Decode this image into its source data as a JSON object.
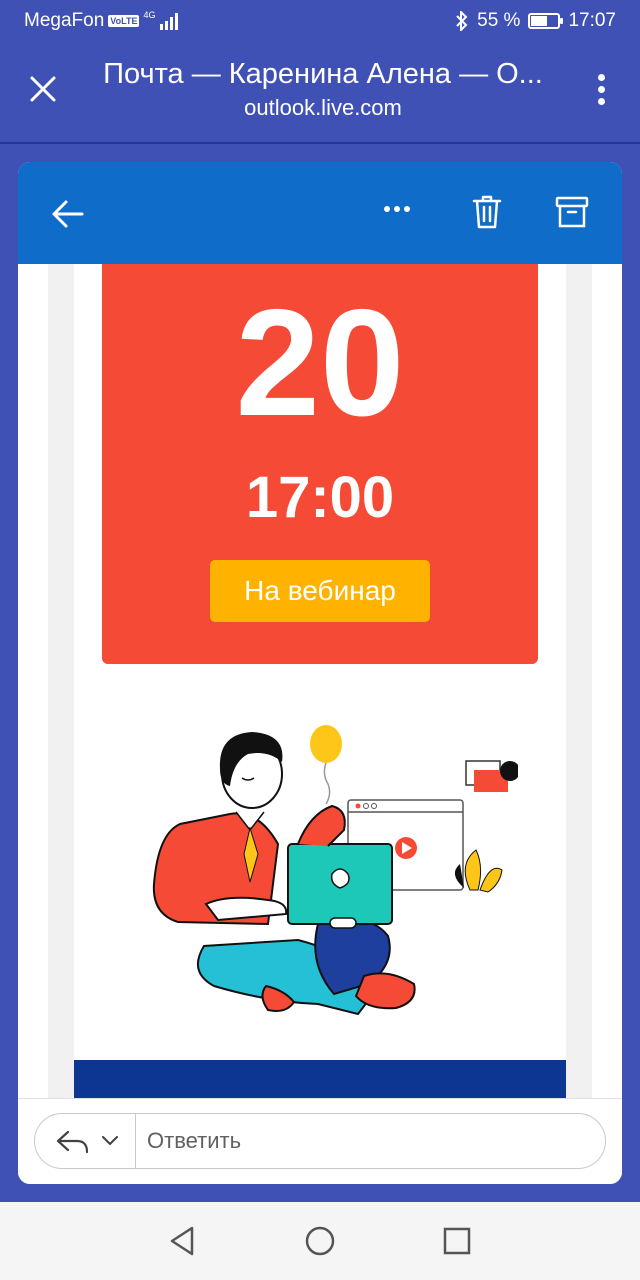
{
  "status_bar": {
    "carrier": "MegaFon",
    "volte": "VoLTE",
    "network": "4G",
    "battery_percent": "55 %",
    "battery_level": 0.55,
    "time": "17:07",
    "bluetooth_icon": "bluetooth-icon"
  },
  "browser": {
    "title": "Почта — Каренина Алена — О...",
    "url": "outlook.live.com",
    "close_icon": "close-icon",
    "more_icon": "more-vertical-icon"
  },
  "mail_toolbar": {
    "back_icon": "arrow-left-icon",
    "more_icon": "more-horizontal-icon",
    "delete_icon": "trash-icon",
    "archive_icon": "archive-icon",
    "color": "#0f6cc9"
  },
  "promo": {
    "day": "20",
    "time": "17:00",
    "button_label": "На вебинар",
    "bg_color": "#f54b36",
    "button_color": "#ffb300"
  },
  "reply": {
    "placeholder": "Ответить",
    "reply_icon": "reply-icon",
    "chevron_icon": "chevron-down-icon"
  },
  "nav": {
    "back_icon": "triangle-back-icon",
    "home_icon": "circle-home-icon",
    "recent_icon": "square-recent-icon"
  }
}
